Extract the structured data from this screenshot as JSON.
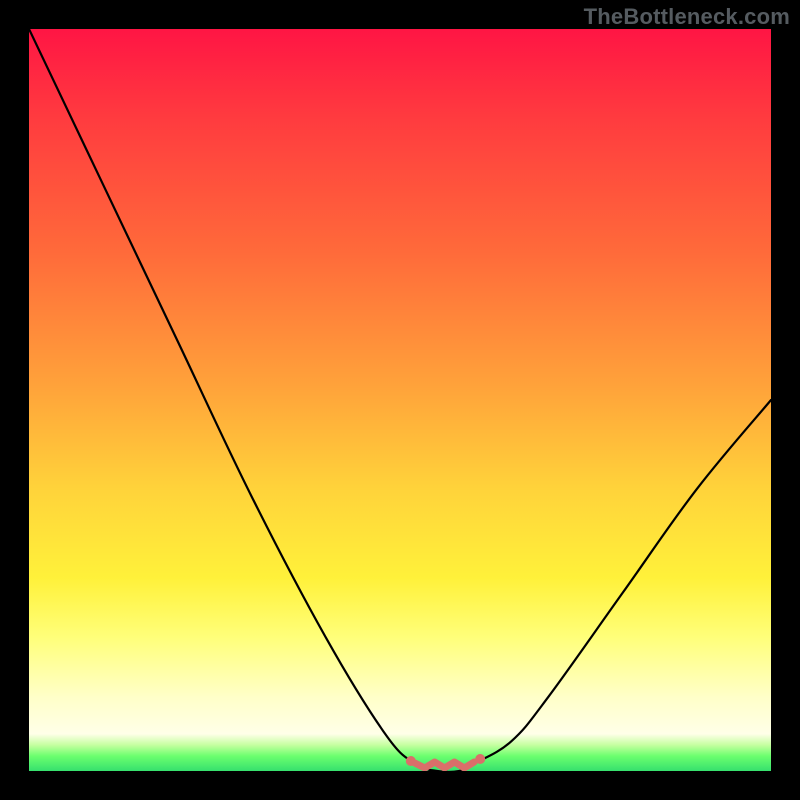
{
  "watermark": "TheBottleneck.com",
  "chart_data": {
    "type": "line",
    "title": "",
    "xlabel": "",
    "ylabel": "",
    "xlim": [
      0,
      100
    ],
    "ylim": [
      0,
      100
    ],
    "series": [
      {
        "name": "bottleneck-curve",
        "x": [
          0,
          10,
          20,
          30,
          40,
          48,
          52,
          55,
          58,
          60,
          65,
          70,
          80,
          90,
          100
        ],
        "values": [
          100,
          79,
          58,
          37,
          18,
          5,
          1,
          0,
          0,
          1,
          4,
          10,
          24,
          38,
          50
        ]
      }
    ],
    "markers": [
      {
        "name": "flat-bottom-band",
        "x_range": [
          52,
          60
        ],
        "y": 0,
        "color": "#da6e6a"
      }
    ],
    "colors": {
      "curve": "#000000",
      "marker": "#da6e6a",
      "bg_top": "#ff1544",
      "bg_bottom": "#36e06e"
    }
  }
}
